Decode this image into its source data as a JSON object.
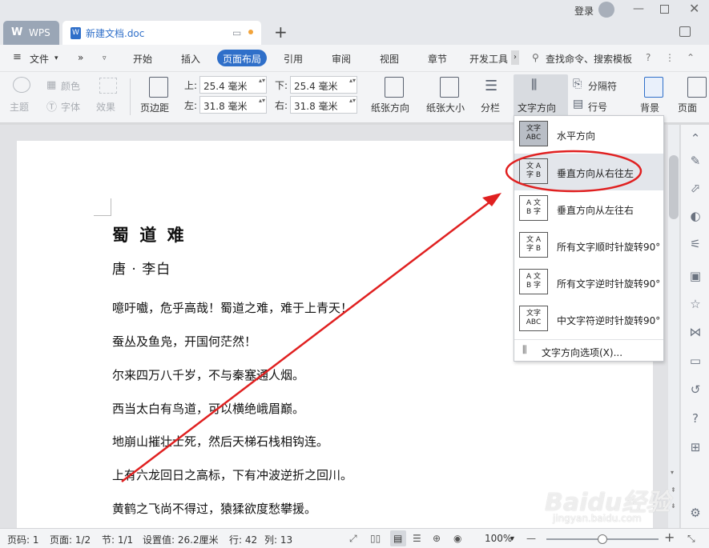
{
  "titlebar": {
    "tabs": [
      {
        "label": "WPS"
      },
      {
        "label": "新建文档.doc"
      }
    ],
    "login_label": "登录",
    "new_tab": "+"
  },
  "menu": {
    "file": "文件",
    "tabs": [
      "开始",
      "插入",
      "页面布局",
      "引用",
      "审阅",
      "视图",
      "章节",
      "开发工具"
    ],
    "active_tab": "页面布局",
    "search_placeholder": "查找命令、搜索模板"
  },
  "ribbon": {
    "theme": "主题",
    "color": "颜色",
    "font": "字体",
    "effect": "效果",
    "margins": "页边距",
    "top_label": "上:",
    "top_value": "25.4 毫米",
    "bottom_label": "下:",
    "bottom_value": "25.4 毫米",
    "left_label": "左:",
    "left_value": "31.8 毫米",
    "right_label": "右:",
    "right_value": "31.8 毫米",
    "orientation": "纸张方向",
    "size": "纸张大小",
    "columns": "分栏",
    "text_direction": "文字方向",
    "separator": "分隔符",
    "line_numbers": "行号",
    "background": "背景",
    "page_border": "页面"
  },
  "dropdown": {
    "items": [
      {
        "label": "水平方向",
        "icon": "horizontal-text-icon"
      },
      {
        "label": "垂直方向从右往左",
        "icon": "vertical-rtl-icon"
      },
      {
        "label": "垂直方向从左往右",
        "icon": "vertical-ltr-icon"
      },
      {
        "label": "所有文字顺时针旋转90°",
        "icon": "rotate-cw-icon"
      },
      {
        "label": "所有文字逆时针旋转90°",
        "icon": "rotate-ccw-icon"
      },
      {
        "label": "中文字符逆时针旋转90°",
        "icon": "cjk-rotate-ccw-icon"
      }
    ],
    "options": "文字方向选项(X)...",
    "highlighted": "垂直方向从右往左"
  },
  "document": {
    "title": "蜀 道 难",
    "author": "唐 · 李白",
    "lines": [
      "噫吁嚱，危乎高哉！蜀道之难，难于上青天！",
      "蚕丛及鱼凫，开国何茫然！",
      "尔来四万八千岁，不与秦塞通人烟。",
      "西当太白有鸟道，可以横绝峨眉巅。",
      "地崩山摧壮士死，然后天梯石栈相钩连。",
      "上有六龙回日之高标，下有冲波逆折之回川。",
      "黄鹤之飞尚不得过，猿猱欲度愁攀援。"
    ]
  },
  "status": {
    "page_num": "页码: 1",
    "pages": "页面: 1/2",
    "section": "节: 1/1",
    "setting": "设置值: 26.2厘米",
    "row": "行: 42",
    "col": "列: 13",
    "zoom": "100%",
    "zoom_level": 0.5
  },
  "watermark": {
    "brand": "Baidu经验",
    "url": "jingyan.baidu.com"
  },
  "colors": {
    "accent": "#2f6fc9",
    "annotation": "#e02020",
    "dropdown_highlight": "#e3e6eb"
  }
}
